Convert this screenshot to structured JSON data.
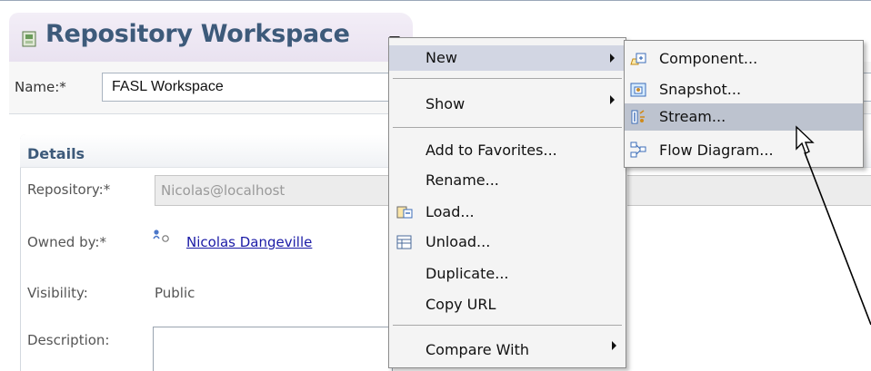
{
  "editor": {
    "title": "Repository Workspace",
    "icon": "workspace-icon",
    "name_label": "Name:*",
    "name_value": "FASL Workspace"
  },
  "details": {
    "title": "Details",
    "repository_label": "Repository:*",
    "repository_value": "Nicolas@localhost",
    "owned_by_label": "Owned by:*",
    "owned_by_value": "Nicolas Dangeville",
    "visibility_label": "Visibility:",
    "visibility_value": "Public",
    "description_label": "Description:"
  },
  "context_menu": {
    "items": [
      {
        "label": "New",
        "icon": "",
        "has_submenu": true,
        "highlighted": true
      },
      {
        "label": "Show",
        "icon": "",
        "has_submenu": true,
        "highlighted": false
      },
      {
        "label": "Add to Favorites...",
        "icon": "",
        "has_submenu": false,
        "highlighted": false
      },
      {
        "label": "Rename...",
        "icon": "",
        "has_submenu": false,
        "highlighted": false
      },
      {
        "label": "Load...",
        "icon": "load-icon",
        "has_submenu": false,
        "highlighted": false
      },
      {
        "label": "Unload...",
        "icon": "unload-icon",
        "has_submenu": false,
        "highlighted": false
      },
      {
        "label": "Duplicate...",
        "icon": "",
        "has_submenu": false,
        "highlighted": false
      },
      {
        "label": "Copy URL",
        "icon": "",
        "has_submenu": false,
        "highlighted": false
      },
      {
        "label": "Compare With",
        "icon": "",
        "has_submenu": true,
        "highlighted": false
      }
    ]
  },
  "new_submenu": {
    "items": [
      {
        "label": "Component...",
        "icon": "component-icon",
        "highlighted": false
      },
      {
        "label": "Snapshot...",
        "icon": "snapshot-icon",
        "highlighted": false
      },
      {
        "label": "Stream...",
        "icon": "stream-icon",
        "highlighted": true
      },
      {
        "label": "Flow Diagram...",
        "icon": "flow-diagram-icon",
        "highlighted": false
      }
    ]
  },
  "colors": {
    "title_text": "#3d5a7a",
    "link": "#1a1aa6",
    "menu_bg": "#f4f4f4",
    "menu_highlight": "#d2d6e3",
    "submenu_highlight": "#bdc3cf"
  }
}
